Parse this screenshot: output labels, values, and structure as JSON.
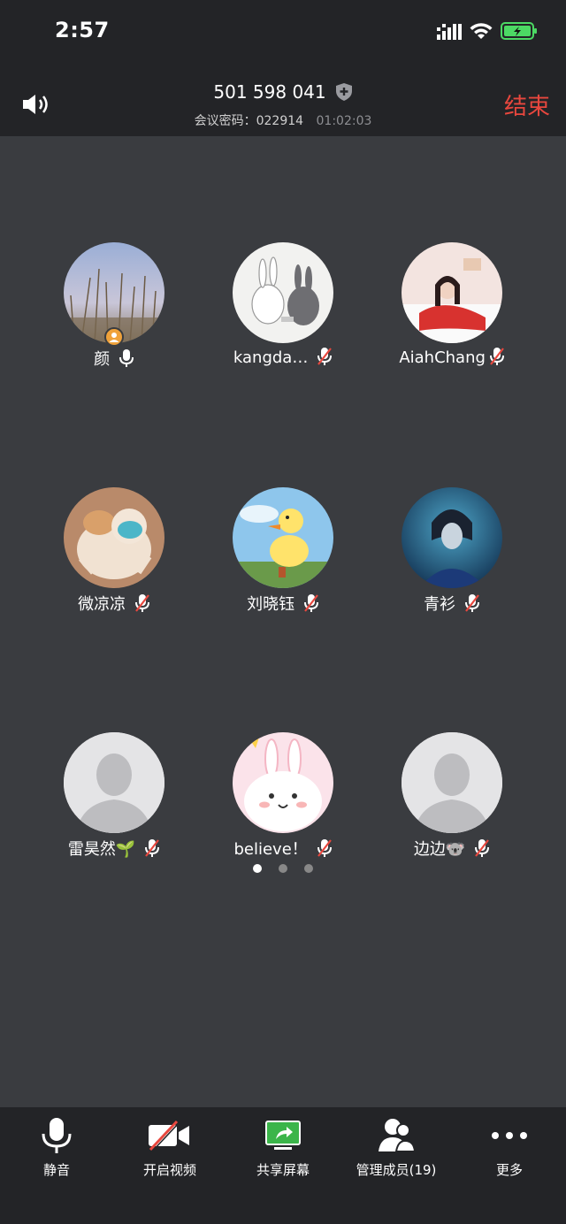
{
  "status_bar": {
    "time": "2:57"
  },
  "header": {
    "meeting_id": "501 598 041",
    "password_label": "会议密码：022914",
    "duration": "01:02:03",
    "end_label": "结束"
  },
  "participants": [
    {
      "name": "颜",
      "muted": false,
      "host": true
    },
    {
      "name": "kangda…",
      "muted": true
    },
    {
      "name": "AiahChang",
      "muted": true
    },
    {
      "name": "微凉凉",
      "muted": true
    },
    {
      "name": "刘晓钰",
      "muted": true
    },
    {
      "name": "青衫",
      "muted": true
    },
    {
      "name": "雷昊然🌱",
      "muted": true
    },
    {
      "name": "believe！",
      "muted": true
    },
    {
      "name": "边边🐨",
      "muted": true
    }
  ],
  "pagination": {
    "pages": 3,
    "current": 1
  },
  "toolbar": {
    "mute_label": "静音",
    "video_label": "开启视频",
    "share_label": "共享屏幕",
    "members_label": "管理成员(19)",
    "more_label": "更多"
  },
  "colors": {
    "end": "#e8473e",
    "share": "#3bb54a",
    "host_badge": "#f0a23a",
    "battery": "#4cd964"
  }
}
